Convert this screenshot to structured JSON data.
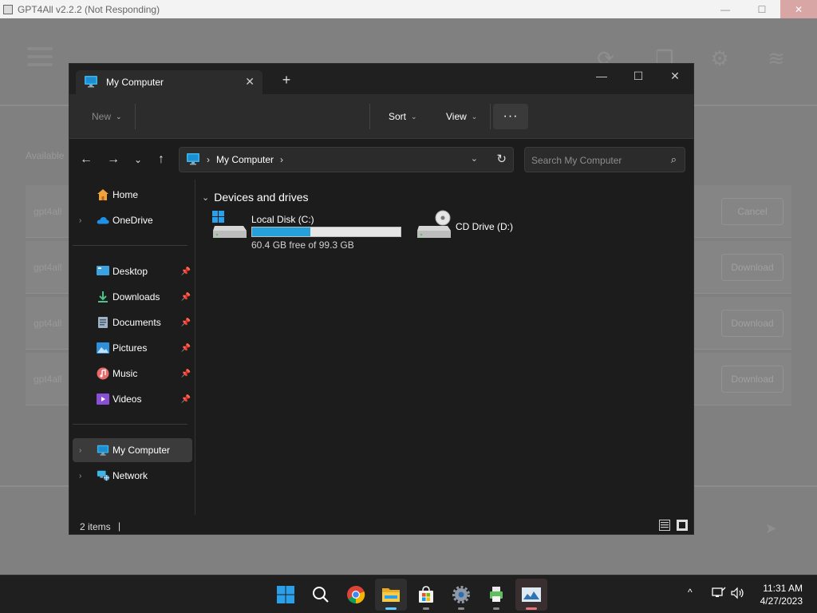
{
  "background_app": {
    "title": "GPT4All v2.2.2 (Not Responding)",
    "available_label": "Available",
    "rows": [
      {
        "name": "gpt4all",
        "button": "Cancel"
      },
      {
        "name": "gpt4all",
        "button": "Download"
      },
      {
        "name": "gpt4all",
        "button": "Download"
      },
      {
        "name": "gpt4all",
        "button": "Download"
      }
    ]
  },
  "explorer": {
    "tab_title": "My Computer",
    "toolbar": {
      "new_label": "New",
      "sort_label": "Sort",
      "view_label": "View",
      "more_label": "···"
    },
    "address": {
      "crumb": "My Computer"
    },
    "search": {
      "placeholder": "Search My Computer"
    },
    "sidebar": {
      "home": "Home",
      "onedrive": "OneDrive",
      "desktop": "Desktop",
      "downloads": "Downloads",
      "documents": "Documents",
      "pictures": "Pictures",
      "music": "Music",
      "videos": "Videos",
      "my_computer": "My Computer",
      "network": "Network"
    },
    "group_title": "Devices and drives",
    "drives": [
      {
        "name": "Local Disk (C:)",
        "free_text": "60.4 GB free of 99.3 GB",
        "used_fraction": 0.392
      },
      {
        "name": "CD Drive (D:)"
      }
    ],
    "status": {
      "item_count": "2 items"
    }
  },
  "taskbar": {
    "time": "11:31 AM",
    "date": "4/27/2023"
  },
  "colors": {
    "accent": "#60cdff",
    "drive_bar": "#26a0da",
    "explorer_bg": "#1c1c1c"
  }
}
